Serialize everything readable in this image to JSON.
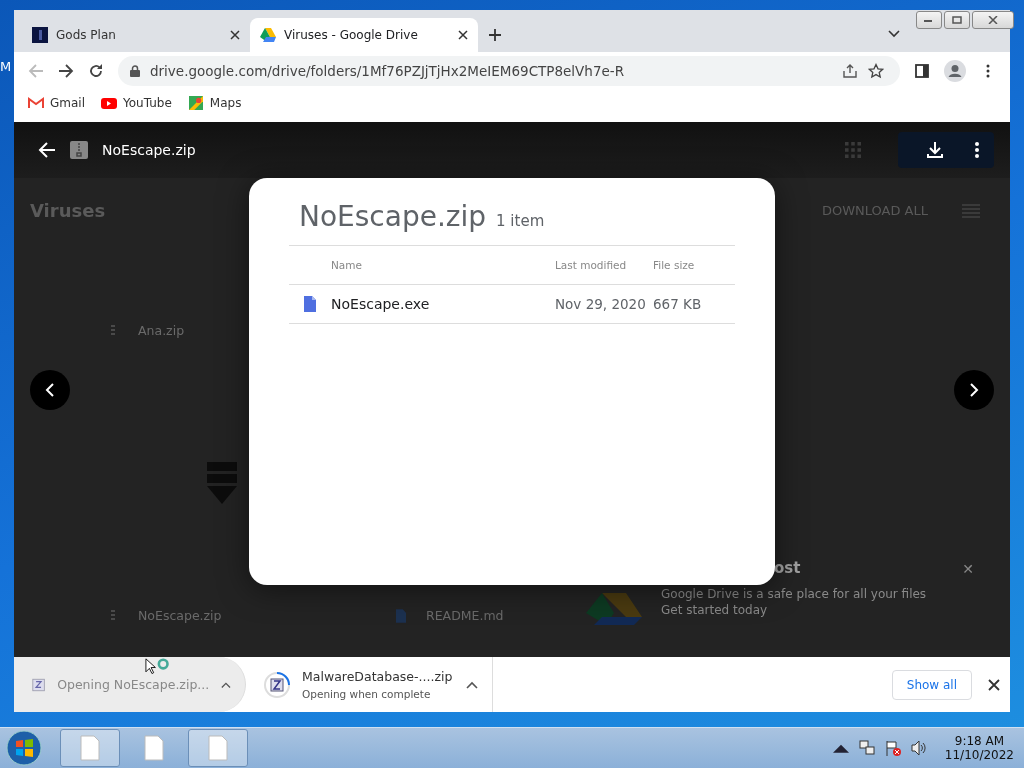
{
  "desktop": {
    "edge_text": "M"
  },
  "browser": {
    "tabs": [
      {
        "title": "Gods Plan",
        "selected": false
      },
      {
        "title": "Viruses - Google Drive",
        "selected": true
      }
    ],
    "address": "drive.google.com/drive/folders/1Mf76PZJjTjHx2MeIEM69CTP8elVh7e-R",
    "bookmarks": [
      {
        "label": "Gmail",
        "kind": "gmail"
      },
      {
        "label": "YouTube",
        "kind": "youtube"
      },
      {
        "label": "Maps",
        "kind": "maps"
      }
    ]
  },
  "viewer": {
    "file_name": "NoEscape.zip"
  },
  "background": {
    "folder_title": "Viruses",
    "download_all": "DOWNLOAD ALL",
    "files": [
      {
        "name": "Ana.zip",
        "kind": "zip"
      },
      {
        "name": "NoEscape.zip",
        "kind": "zip"
      },
      {
        "name": "README.md",
        "kind": "doc"
      }
    ],
    "promo": {
      "title": "ost",
      "line_1": "Google Drive is a safe place for all your files",
      "line_2": "Get started today"
    }
  },
  "archive": {
    "title": "NoEscape.zip",
    "count": "1 item",
    "columns": [
      "Name",
      "Last modified",
      "File size"
    ],
    "rows": [
      {
        "name": "NoEscape.exe",
        "modified": "Nov 29, 2020",
        "size": "667 KB"
      }
    ]
  },
  "downloads": [
    {
      "name": "Opening NoEscape.zip...",
      "disabled": true
    },
    {
      "name": "MalwareDatabase-....zip",
      "status": "Opening when complete",
      "disabled": false
    }
  ],
  "show_all": "Show all",
  "close_glyph": "✕",
  "taskbar": {
    "buttons": [
      {
        "selected": true
      },
      {
        "selected": false
      },
      {
        "selected": true
      }
    ],
    "time": "9:18 AM",
    "date": "11/10/2022"
  }
}
